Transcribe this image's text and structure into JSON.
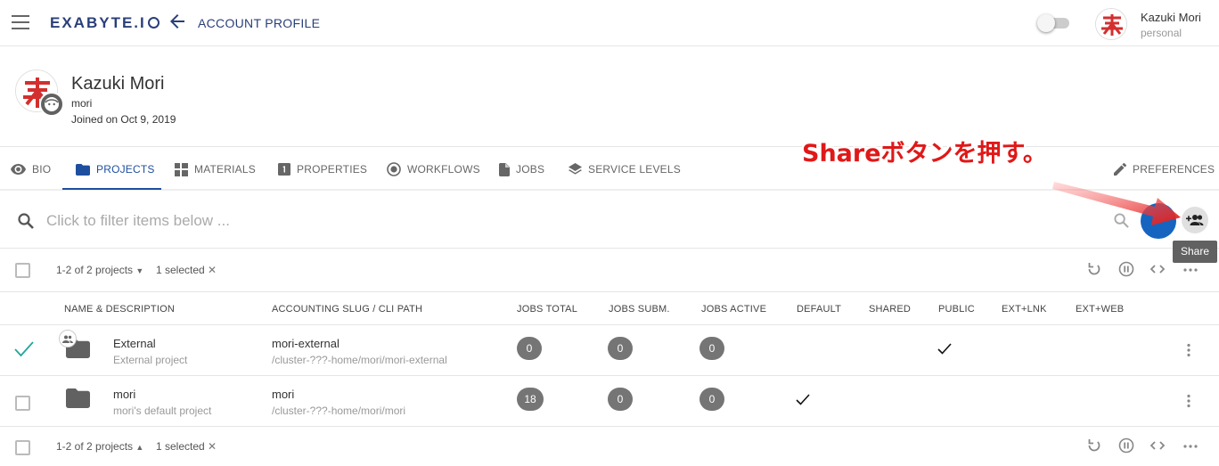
{
  "topbar": {
    "brand": "EXABYTE.I",
    "page_title": "ACCOUNT PROFILE",
    "user_name": "Kazuki Mori",
    "user_account_type": "personal"
  },
  "profile": {
    "name": "Kazuki Mori",
    "login": "mori",
    "joined": "Joined on Oct 9, 2019"
  },
  "tabs": [
    {
      "label": "BIO",
      "icon": "eye-icon"
    },
    {
      "label": "PROJECTS",
      "icon": "folder-icon",
      "active": true
    },
    {
      "label": "MATERIALS",
      "icon": "materials-icon"
    },
    {
      "label": "PROPERTIES",
      "icon": "properties-icon"
    },
    {
      "label": "WORKFLOWS",
      "icon": "workflows-icon"
    },
    {
      "label": "JOBS",
      "icon": "file-icon"
    },
    {
      "label": "SERVICE LEVELS",
      "icon": "layers-icon"
    },
    {
      "label": "PREFERENCES",
      "icon": "pencil-icon"
    }
  ],
  "filter": {
    "placeholder": "Click to filter items below ..."
  },
  "share_tooltip": "Share",
  "annotation": "Shareボタンを押す。",
  "toolbar_top": {
    "range": "1-2 of 2 projects",
    "selected": "1 selected"
  },
  "toolbar_bottom": {
    "range": "1-2 of 2 projects",
    "selected": "1 selected"
  },
  "columns": [
    "NAME & DESCRIPTION",
    "ACCOUNTING SLUG / CLI PATH",
    "JOBS TOTAL",
    "JOBS SUBM.",
    "JOBS ACTIVE",
    "DEFAULT",
    "SHARED",
    "PUBLIC",
    "EXT+LNK",
    "EXT+WEB"
  ],
  "rows": [
    {
      "name": "External",
      "description": "External project",
      "slug": "mori-external",
      "path": "/cluster-???-home/mori/mori-external",
      "jobs_total": "0",
      "jobs_subm": "0",
      "jobs_active": "0",
      "default": false,
      "public": true,
      "selected": true,
      "shared_badge": true
    },
    {
      "name": "mori",
      "description": "mori's default project",
      "slug": "mori",
      "path": "/cluster-???-home/mori/mori",
      "jobs_total": "18",
      "jobs_subm": "0",
      "jobs_active": "0",
      "default": true,
      "public": false,
      "selected": false,
      "shared_badge": false
    }
  ],
  "colors": {
    "brand": "#2a3f7a",
    "accent": "#1e4f9f",
    "fab": "#1565c0",
    "annotation": "#e01818",
    "check_teal": "#26a69a"
  }
}
